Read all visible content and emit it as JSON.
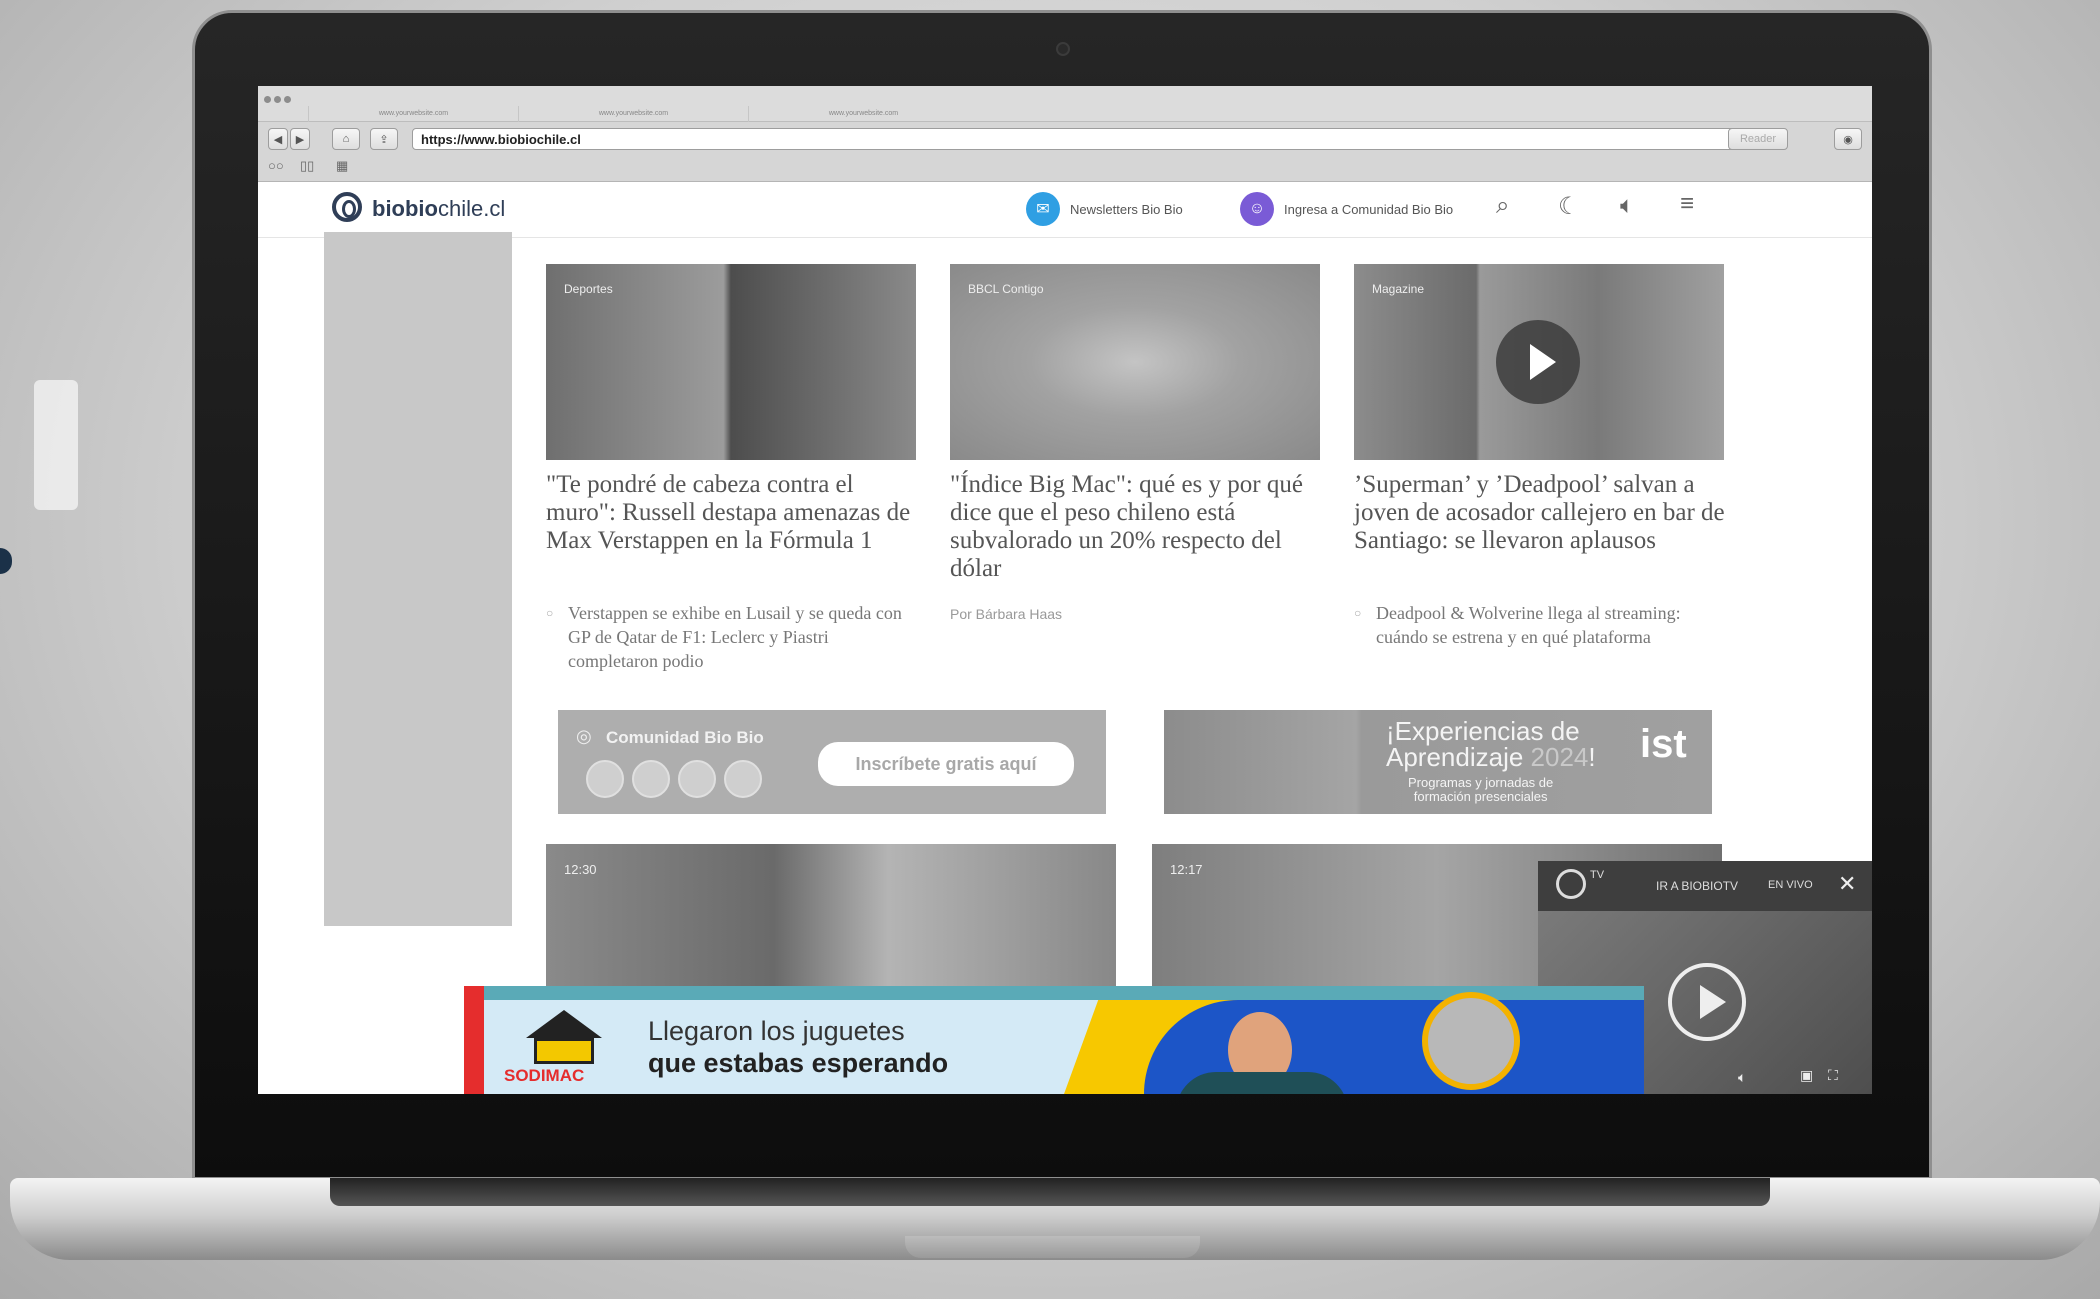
{
  "browser": {
    "url": "https://www.biobiochile.cl",
    "reader_label": "Reader",
    "tabs": [
      "www.yourwebsite.com",
      "www.yourwebsite.com",
      "www.yourwebsite.com"
    ]
  },
  "site": {
    "logo_bold": "biobio",
    "logo_rest": "chile.cl",
    "header": {
      "newsletter_label": "Newsletters Bio Bio",
      "community_label": "Ingresa a Comunidad Bio Bio"
    }
  },
  "articles": [
    {
      "tag": "Deportes",
      "headline": "\"Te pondré de cabeza contra el muro\": Russell destapa amenazas de Max Verstappen en la Fórmula 1",
      "related": "Verstappen se exhibe en Lusail y se queda con GP de Qatar de F1: Leclerc y Piastri completaron podio"
    },
    {
      "tag": "BBCL Contigo",
      "headline": "\"Índice Big Mac\": qué es y por qué dice que el peso chileno está subvalorado un 20% respecto del dólar",
      "byline": "Por Bárbara Haas"
    },
    {
      "tag": "Magazine",
      "headline": "’Superman’ y ’Deadpool’ salvan a joven de acosador callejero en bar de Santiago: se llevaron aplausos",
      "related": "Deadpool & Wolverine llega al streaming: cuándo se estrena y en qué plataforma"
    }
  ],
  "community_banner": {
    "title": "Comunidad Bio Bio",
    "cta": "Inscríbete gratis aquí"
  },
  "ist_banner": {
    "title_line1": "¡Experiencias de",
    "title_line2": "Aprendizaje",
    "title_year": "2024",
    "title_end": "!",
    "subtitle_line1": "Programas y jornadas de",
    "subtitle_line2": "formación presenciales",
    "brand": "ist"
  },
  "videos": [
    {
      "time": "12:30"
    },
    {
      "time": "12:17"
    }
  ],
  "tv_widget": {
    "brand": "TV",
    "link": "IR A BIOBIOTV",
    "live": "EN VIVO"
  },
  "ad": {
    "brand": "SODIMAC",
    "line1": "Llegaron los juguetes",
    "line2": "que estabas esperando"
  }
}
